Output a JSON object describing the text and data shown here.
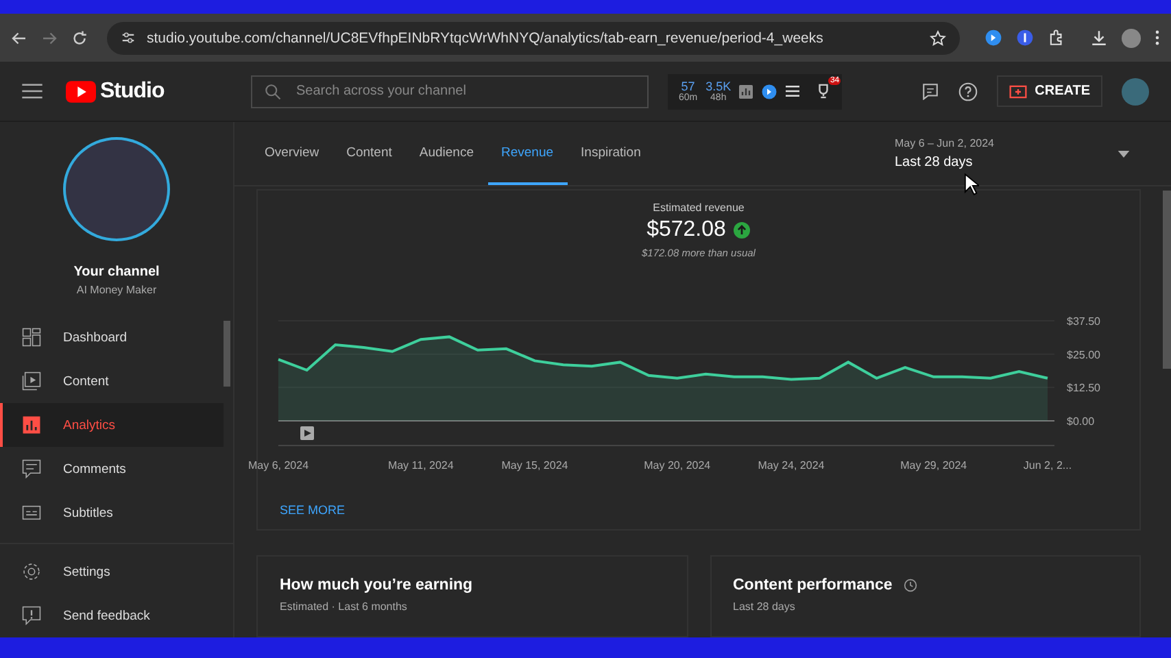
{
  "browser": {
    "url": "studio.youtube.com/channel/UC8EVfhpEINbRYtqcWrWhNYQ/analytics/tab-earn_revenue/period-4_weeks"
  },
  "header": {
    "logo_text": "Studio",
    "search_placeholder": "Search across your channel",
    "stats": [
      {
        "value": "57",
        "sub": "60m"
      },
      {
        "value": "3.5K",
        "sub": "48h"
      }
    ],
    "badge": "34",
    "create_label": "CREATE"
  },
  "sidebar": {
    "channel_title": "Your channel",
    "channel_name": "AI Money Maker",
    "items": [
      {
        "label": "Dashboard",
        "selected": false
      },
      {
        "label": "Content",
        "selected": false
      },
      {
        "label": "Analytics",
        "selected": true
      },
      {
        "label": "Comments",
        "selected": false
      },
      {
        "label": "Subtitles",
        "selected": false
      }
    ],
    "footer_items": [
      {
        "label": "Settings"
      },
      {
        "label": "Send feedback"
      }
    ]
  },
  "tabs": [
    {
      "label": "Overview",
      "selected": false
    },
    {
      "label": "Content",
      "selected": false
    },
    {
      "label": "Audience",
      "selected": false
    },
    {
      "label": "Revenue",
      "selected": true
    },
    {
      "label": "Inspiration",
      "selected": false
    }
  ],
  "date_range": {
    "range": "May 6 – Jun 2, 2024",
    "label": "Last 28 days"
  },
  "metric": {
    "label": "Estimated revenue",
    "value": "$572.08",
    "note": "$172.08 more than usual"
  },
  "chart_data": {
    "type": "area",
    "categories": [
      "May 6, 2024",
      null,
      null,
      null,
      null,
      "May 11, 2024",
      null,
      null,
      null,
      "May 15, 2024",
      null,
      null,
      null,
      null,
      "May 20, 2024",
      null,
      null,
      null,
      "May 24, 2024",
      null,
      null,
      null,
      null,
      "May 29, 2024",
      null,
      null,
      null,
      "Jun 2, 2..."
    ],
    "series": [
      {
        "color": "#3ecf9c",
        "values": [
          23,
          19,
          28.5,
          27.5,
          26,
          30.5,
          31.5,
          26.5,
          27,
          22.5,
          21,
          20.5,
          22,
          17,
          16,
          17.5,
          16.5,
          16.5,
          15.5,
          16,
          22,
          16,
          20,
          16.5,
          16.5,
          16,
          18.5,
          16
        ]
      }
    ],
    "yticks": [
      {
        "value": 0,
        "label": "$0.00"
      },
      {
        "value": 12.5,
        "label": "$12.50"
      },
      {
        "value": 25,
        "label": "$25.00"
      },
      {
        "value": 37.5,
        "label": "$37.50"
      }
    ],
    "ylim": [
      0,
      37.5
    ]
  },
  "see_more": "SEE MORE",
  "cards": [
    {
      "title": "How much you’re earning",
      "subtitle": "Estimated · Last 6 months",
      "kind": "plain"
    },
    {
      "title": "Content performance",
      "subtitle": "Last 28 days",
      "kind": "clock"
    }
  ]
}
